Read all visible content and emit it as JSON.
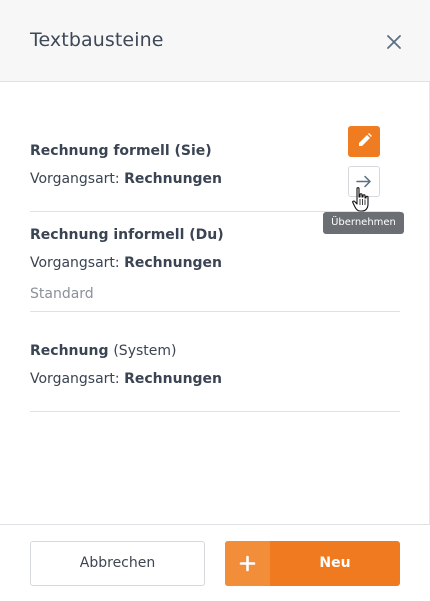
{
  "header": {
    "title": "Textbausteine"
  },
  "items": [
    {
      "title": "Rechnung formell (Sie)",
      "title_suffix": "",
      "type_label": "Vorgangsart:",
      "type_value": "Rechnungen",
      "standard": ""
    },
    {
      "title": "Rechnung informell (Du)",
      "title_suffix": "",
      "type_label": "Vorgangsart:",
      "type_value": "Rechnungen",
      "standard": "Standard"
    },
    {
      "title": "Rechnung",
      "title_suffix": "(System)",
      "type_label": "Vorgangsart:",
      "type_value": "Rechnungen",
      "standard": ""
    }
  ],
  "actions": {
    "tooltip": "Übernehmen"
  },
  "footer": {
    "cancel_label": "Abbrechen",
    "new_label": "Neu"
  },
  "colors": {
    "accent": "#ef7a1f",
    "accent_light": "#f28e3a",
    "tooltip_bg": "#6b6f73"
  },
  "icons": {
    "close": "close-icon",
    "edit": "pencil-icon",
    "apply": "arrow-right-icon",
    "add": "plus-icon"
  }
}
